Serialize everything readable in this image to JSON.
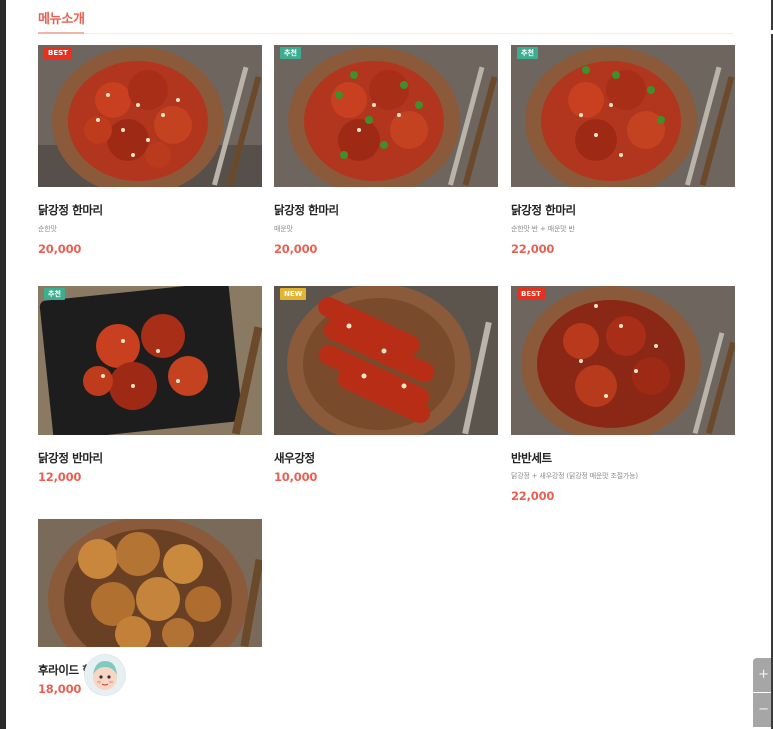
{
  "section": {
    "title": "메뉴소개"
  },
  "menu": [
    {
      "name": "닭강정 한마리",
      "desc": "순한맛",
      "price": "20,000",
      "badge": "BEST",
      "badge_type": "best",
      "icon": "fried-chicken-plate-photo"
    },
    {
      "name": "닭강정 한마리",
      "desc": "매운맛",
      "price": "20,000",
      "badge": "추천",
      "badge_type": "rec",
      "icon": "spicy-chicken-plate-photo"
    },
    {
      "name": "닭강정 한마리",
      "desc": "순한맛 반 + 매운맛 반",
      "price": "22,000",
      "badge": "추천",
      "badge_type": "rec",
      "icon": "half-half-chicken-plate-photo"
    },
    {
      "name": "닭강정 반마리",
      "desc": "",
      "price": "12,000",
      "badge": "추천",
      "badge_type": "rec",
      "icon": "chicken-tray-photo"
    },
    {
      "name": "새우강정",
      "desc": "",
      "price": "10,000",
      "badge": "NEW",
      "badge_type": "new",
      "icon": "shrimp-plate-photo"
    },
    {
      "name": "반반세트",
      "desc": "닭강정 + 새우강정 (닭강정 매운맛 조절가능)",
      "price": "22,000",
      "badge": "BEST",
      "badge_type": "best",
      "icon": "combo-set-plate-photo"
    },
    {
      "name": "후라이드 한",
      "desc": "",
      "price": "18,000",
      "badge": "",
      "badge_type": "",
      "icon": "fried-chicken-photo"
    }
  ],
  "side_controls": {
    "up": "+",
    "down": "−"
  },
  "colors": {
    "accent": "#e76153",
    "best": "#e53220",
    "recommend": "#3bae8f",
    "new": "#e3b332"
  }
}
